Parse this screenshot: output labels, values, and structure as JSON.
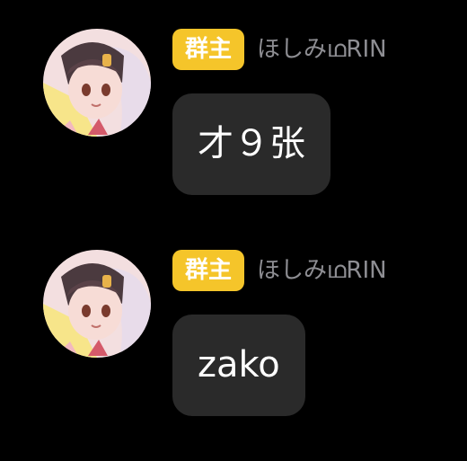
{
  "messages": [
    {
      "role_badge": "群主",
      "sender_name": "ほしみഥRIN",
      "text": "才９张"
    },
    {
      "role_badge": "群主",
      "sender_name": "ほしみഥRIN",
      "text": "zako"
    }
  ],
  "colors": {
    "background": "#000000",
    "bubble": "#2a2a2a",
    "badge": "#f5c52a",
    "name_text": "#8e8e93"
  },
  "icons": {
    "avatar": "anime-girl-avatar"
  }
}
